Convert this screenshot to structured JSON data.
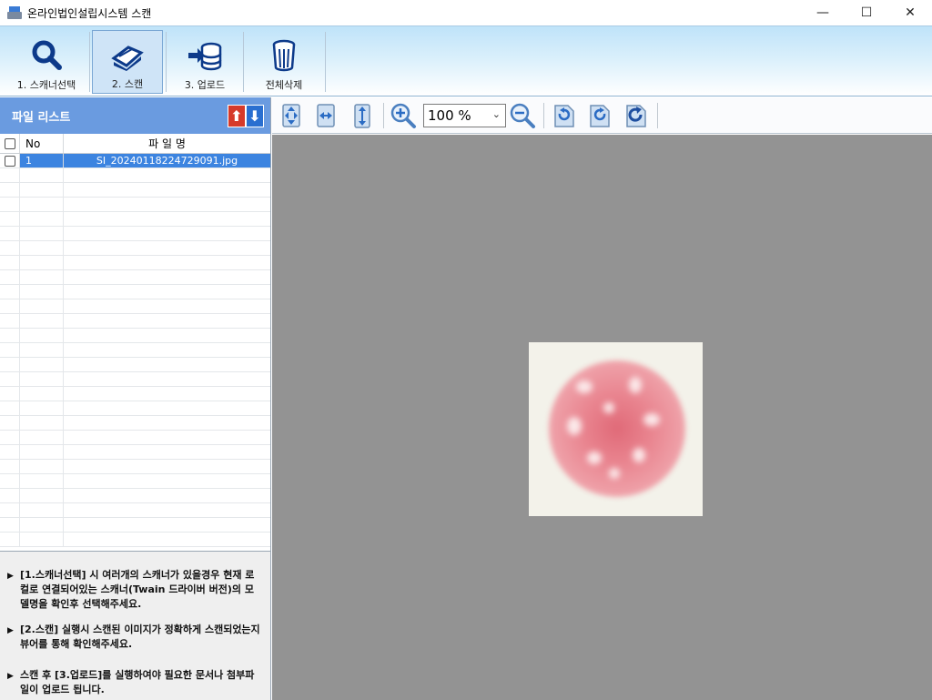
{
  "window": {
    "title": "온라인법인설립시스템 스캔",
    "minimize": "—",
    "maximize": "☐",
    "close": "✕"
  },
  "toolbar": {
    "buttons": [
      {
        "label": "1. 스캐너선택",
        "icon": "magnifier-icon"
      },
      {
        "label": "2. 스캔",
        "icon": "scanner-icon",
        "active": true
      },
      {
        "label": "3. 업로드",
        "icon": "upload-database-icon"
      },
      {
        "label": "전체삭제",
        "icon": "trash-icon"
      }
    ]
  },
  "file_list": {
    "title": "파일 리스트",
    "sort_up": "⬆",
    "sort_down": "⬇",
    "columns": {
      "no": "No",
      "name": "파 일 명"
    },
    "rows": [
      {
        "no": "1",
        "name": "SI_20240118224729091.jpg",
        "selected": true
      }
    ]
  },
  "viewer": {
    "zoom": "100 %",
    "zoom_chevron": "⌄"
  },
  "help": [
    "[1.스캐너선택] 시 여러개의 스캐너가 있을경우 현재 로컬로 연결되어있는 스캐너(Twain 드라이버 버전)의 모델명을 확인후 선택해주세요.",
    "[2.스캔] 실행시 스캔된 이미지가 정확하게 스캔되었는지 뷰어를 통해 확인해주세요.",
    "스캔 후 [3.업로드]를 실행하여야 필요한 문서나 첨부파일이 업로드 됩니다."
  ],
  "help_bullet": "▶",
  "colors": {
    "accent": "#6a9be0",
    "selection": "#3c84e0",
    "canvas": "#939393",
    "seal": "#e06a78"
  }
}
